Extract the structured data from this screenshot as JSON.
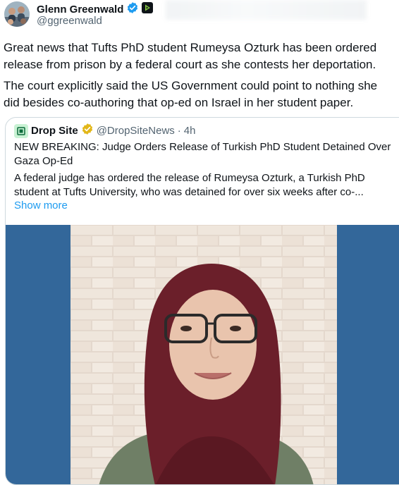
{
  "author": {
    "name": "Glenn Greenwald",
    "handle": "@ggreenwald",
    "verified_icon": "verified-badge-icon",
    "affiliate_icon": "rumble-badge-icon"
  },
  "tweet": {
    "paragraph1": "Great news that Tufts PhD student Rumeysa Ozturk has been ordered release from prison by a federal court as she contests her deportation.",
    "paragraph2": "The court explicitly said the US Government could point to nothing she did besides co-authoring that op-ed on Israel in her student paper."
  },
  "quote": {
    "name": "Drop Site",
    "handle": "@DropSiteNews",
    "separator": "·",
    "time": "4h",
    "title": "NEW BREAKING: Judge Orders Release of Turkish PhD Student Detained Over Gaza Op-Ed",
    "summary": "A federal judge has ordered the release of Rumeysa Ozturk, a Turkish PhD student at Tufts University, who was detained for over six weeks after co-...",
    "show_more": "Show more",
    "media_icon": "photo-image"
  },
  "colors": {
    "accent": "#1d9bf0",
    "gold_badge": "#e2b719",
    "media_bg": "#33679a",
    "secondary_text": "#536471"
  }
}
